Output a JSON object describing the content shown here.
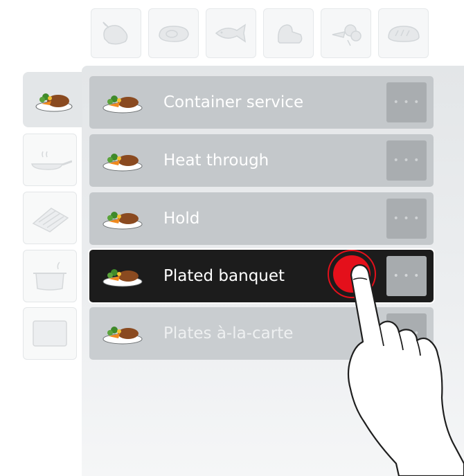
{
  "top_tabs": [
    {
      "name": "poultry",
      "icon": "poultry-icon"
    },
    {
      "name": "meat",
      "icon": "meat-icon"
    },
    {
      "name": "fish",
      "icon": "fish-icon"
    },
    {
      "name": "egg-dishes",
      "icon": "egg-dish-icon"
    },
    {
      "name": "vegetables",
      "icon": "vegetables-icon"
    },
    {
      "name": "baked-goods",
      "icon": "bread-icon"
    }
  ],
  "side_tabs": [
    {
      "name": "finishing",
      "icon": "plated-meal-icon",
      "active": true
    },
    {
      "name": "pan-frying",
      "icon": "frying-pan-icon",
      "active": false
    },
    {
      "name": "grilling",
      "icon": "grill-icon",
      "active": false
    },
    {
      "name": "steaming",
      "icon": "pot-icon",
      "active": false
    },
    {
      "name": "oven",
      "icon": "oven-icon",
      "active": false
    }
  ],
  "programs": [
    {
      "label": "Container service",
      "icon": "plated-meal-icon",
      "more": "..."
    },
    {
      "label": "Heat through",
      "icon": "plated-meal-icon",
      "more": "..."
    },
    {
      "label": "Hold",
      "icon": "plated-meal-icon",
      "more": "..."
    },
    {
      "label": "Plated banquet",
      "icon": "plated-meal-icon",
      "more": "...",
      "selected": true
    },
    {
      "label": "Plates à-la-carte",
      "icon": "plated-meal-icon",
      "more": "..."
    }
  ],
  "colors": {
    "accent": "#e4101b",
    "selected_row": "#1c1c1c",
    "row": "#c4c8cb",
    "more_button": "#a9adb0"
  }
}
